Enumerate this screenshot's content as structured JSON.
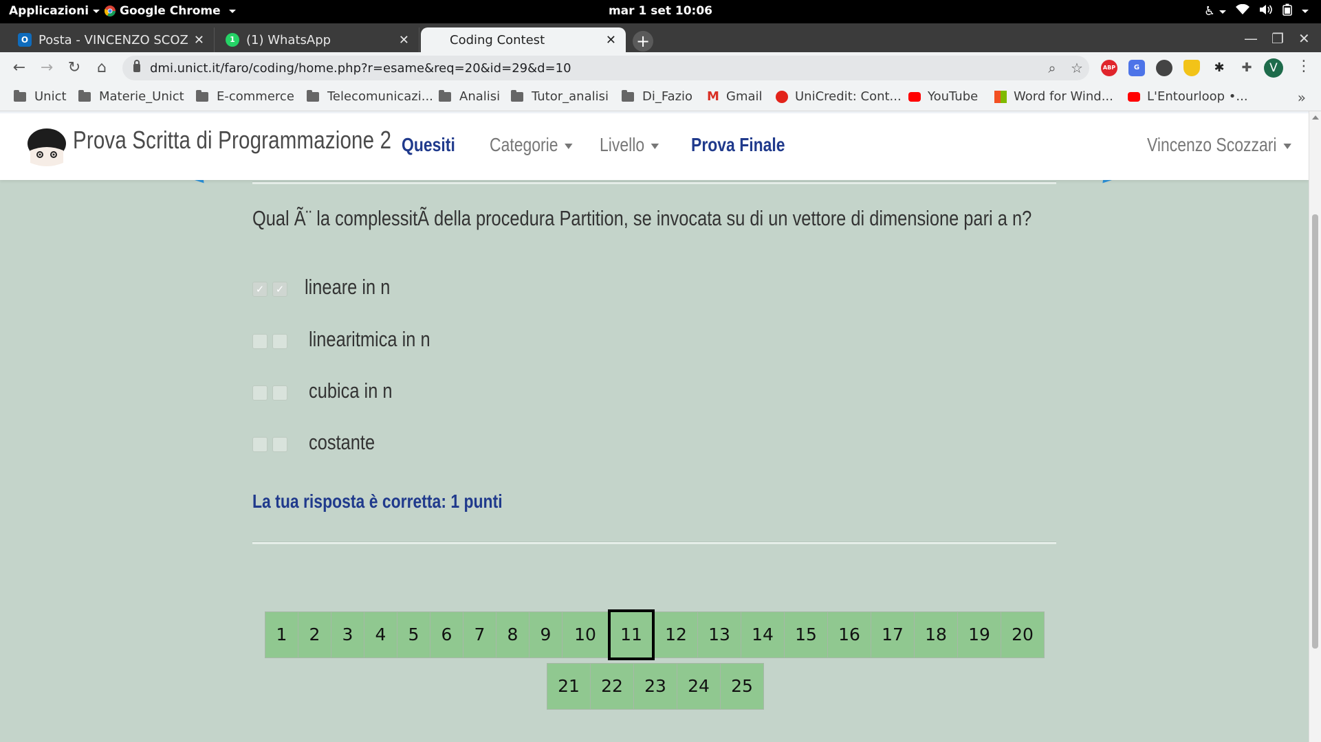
{
  "topbar": {
    "apps_label": "Applicazioni",
    "app_name": "Google Chrome",
    "clock": "mar 1 set  10:06"
  },
  "tabs": [
    {
      "title": "Posta - VINCENZO SCOZZARI - Outlook",
      "favicon_color": "#0f6cbd"
    },
    {
      "title": "(1) WhatsApp",
      "favicon_color": "#25d366"
    },
    {
      "title": "Coding Contest",
      "favicon_color": ""
    }
  ],
  "address_bar": {
    "url": "dmi.unict.it/faro/coding/home.php?r=esame&req=20&id=29&d=10"
  },
  "extensions": [
    {
      "name": "adblock-icon",
      "label": "ABP",
      "color": "#e0252c"
    },
    {
      "name": "translate-icon",
      "label": "G",
      "color": "#4d74e8"
    },
    {
      "name": "extension-icon",
      "label": "",
      "color": "#444444"
    },
    {
      "name": "shield-icon",
      "label": "",
      "color": "#f2c318"
    },
    {
      "name": "extension-icon",
      "label": "",
      "color": "#222222"
    },
    {
      "name": "puzzle-icon",
      "label": "",
      "color": "#666666"
    }
  ],
  "profile_initial": "V",
  "bookmarks": [
    {
      "label": "Unict",
      "icon": "folder-icon"
    },
    {
      "label": "Materie_Unict",
      "icon": "folder-icon"
    },
    {
      "label": "E-commerce",
      "icon": "folder-icon"
    },
    {
      "label": "Telecomunicazi...",
      "icon": "folder-icon"
    },
    {
      "label": "Analisi",
      "icon": "folder-icon"
    },
    {
      "label": "Tutor_analisi",
      "icon": "folder-icon"
    },
    {
      "label": "Di_Fazio",
      "icon": "folder-icon"
    },
    {
      "label": "Gmail",
      "icon": "gmail-icon"
    },
    {
      "label": "UniCredit: Cont...",
      "icon": "unicredit-icon"
    },
    {
      "label": "YouTube",
      "icon": "youtube-icon"
    },
    {
      "label": "Word for Wind...",
      "icon": "microsoft-icon"
    },
    {
      "label": "L'Entourloop •...",
      "icon": "youtube-icon"
    }
  ],
  "site": {
    "brand": "Prova Scritta di Programmazione 2",
    "nav": {
      "quesiti": "Quesiti",
      "categorie": "Categorie",
      "livello": "Livello",
      "prova_finale": "Prova Finale",
      "user": "Vincenzo Scozzari"
    }
  },
  "question": {
    "text": "Qual Ã¨ la complessitÃ  della procedura Partition, se invocata su di un vettore di dimensione pari a n?",
    "options": [
      {
        "label": "lineare in n",
        "checked": true
      },
      {
        "label": "linearitmica in n",
        "checked": false
      },
      {
        "label": "cubica in n",
        "checked": false
      },
      {
        "label": "costante",
        "checked": false
      }
    ],
    "result": "La tua risposta è corretta: 1 punti"
  },
  "pagination": {
    "pages": [
      "1",
      "2",
      "3",
      "4",
      "5",
      "6",
      "7",
      "8",
      "9",
      "10",
      "11",
      "12",
      "13",
      "14",
      "15",
      "16",
      "17",
      "18",
      "19",
      "20",
      "21",
      "22",
      "23",
      "24",
      "25"
    ],
    "current": "11",
    "color": "#90c890"
  }
}
